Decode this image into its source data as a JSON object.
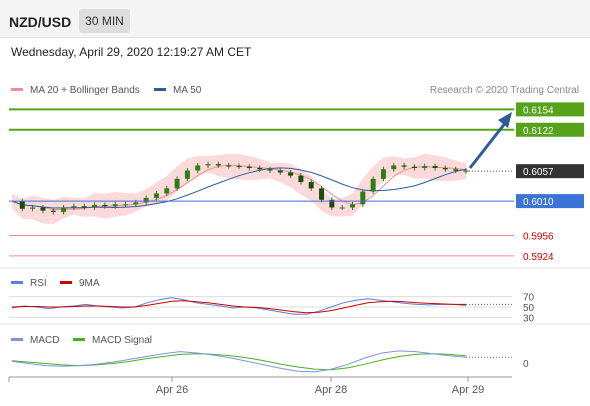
{
  "header": {
    "symbol": "NZD/USD",
    "timeframe": "30 MIN"
  },
  "timestamp": "Wednesday, April 29, 2020 12:19:27 AM CET",
  "credit": "Research © 2020 Trading Central",
  "legend_main": [
    {
      "name": "MA 20 + Bollinger Bands",
      "color": "#f28b8b"
    },
    {
      "name": "MA 50",
      "color": "#2f5b9c"
    }
  ],
  "legend_rsi": [
    {
      "name": "RSI",
      "color": "#5a7fd6"
    },
    {
      "name": "9MA",
      "color": "#cc0000"
    }
  ],
  "legend_macd": [
    {
      "name": "MACD",
      "color": "#7f93e0"
    },
    {
      "name": "MACD Signal",
      "color": "#4caf20"
    }
  ],
  "colors": {
    "resistance": "#56a31a",
    "support": "#3b73d6",
    "lower_level": "#f08a8a",
    "last_price": "#333333",
    "arrow": "#2f5b9c",
    "candle": "#2e7d16",
    "ma20": "#f28b8b",
    "band_fill": "#fbd3d6"
  },
  "chart_data": {
    "type": "candlestick",
    "price_levels": [
      {
        "value": 0.6154,
        "label": "0.6154",
        "kind": "resistance"
      },
      {
        "value": 0.6122,
        "label": "0.6122",
        "kind": "resistance"
      },
      {
        "value": 0.6057,
        "label": "0.6057",
        "kind": "last"
      },
      {
        "value": 0.601,
        "label": "0.6010",
        "kind": "support"
      },
      {
        "value": 0.5956,
        "label": "0.5956",
        "kind": "lower"
      },
      {
        "value": 0.5924,
        "label": "0.5924",
        "kind": "lower"
      }
    ],
    "price_ylim": [
      0.5905,
      0.6175
    ],
    "x_labels": [
      "Apr 26",
      "Apr 28",
      "Apr 29"
    ],
    "close_approx": [
      0.601,
      0.5998,
      0.6,
      0.5995,
      0.5993,
      0.6,
      0.6002,
      0.6,
      0.6004,
      0.6002,
      0.6005,
      0.6005,
      0.6008,
      0.6015,
      0.6022,
      0.603,
      0.6045,
      0.6058,
      0.6066,
      0.6068,
      0.6066,
      0.6065,
      0.6064,
      0.6062,
      0.606,
      0.6058,
      0.6055,
      0.605,
      0.604,
      0.603,
      0.6012,
      0.6,
      0.6,
      0.6005,
      0.6025,
      0.6045,
      0.606,
      0.6066,
      0.6064,
      0.6062,
      0.6065,
      0.6062,
      0.606,
      0.6058,
      0.6057
    ],
    "rsi": {
      "levels": [
        70,
        50,
        30
      ],
      "values": [
        48,
        52,
        50,
        47,
        50,
        52,
        55,
        52,
        50,
        48,
        50,
        58,
        64,
        68,
        64,
        58,
        55,
        52,
        48,
        50,
        48,
        44,
        40,
        36,
        36,
        42,
        50,
        58,
        63,
        66,
        63,
        60,
        57,
        55,
        54,
        55,
        55,
        53
      ],
      "ma9": [
        50,
        51,
        51,
        50,
        50,
        51,
        52,
        52,
        51,
        50,
        50,
        53,
        57,
        61,
        62,
        60,
        58,
        55,
        52,
        50,
        49,
        47,
        44,
        41,
        39,
        40,
        43,
        48,
        53,
        58,
        60,
        61,
        60,
        58,
        57,
        56,
        55,
        55
      ]
    },
    "macd": {
      "zero_label": "0",
      "macd": [
        -0.2,
        -0.5,
        -0.8,
        -0.9,
        -0.8,
        -0.6,
        -0.3,
        0.1,
        0.5,
        0.9,
        1.2,
        1.0,
        0.7,
        0.3,
        -0.2,
        -0.7,
        -1.2,
        -1.6,
        -1.7,
        -1.3,
        -0.6,
        0.3,
        1.0,
        1.3,
        1.2,
        0.9,
        0.6,
        0.4
      ],
      "signal": [
        -0.1,
        -0.3,
        -0.5,
        -0.7,
        -0.8,
        -0.7,
        -0.5,
        -0.2,
        0.2,
        0.5,
        0.8,
        0.9,
        0.8,
        0.6,
        0.3,
        -0.1,
        -0.6,
        -1.0,
        -1.3,
        -1.4,
        -1.1,
        -0.6,
        0.0,
        0.5,
        0.8,
        0.9,
        0.8,
        0.6
      ]
    }
  }
}
